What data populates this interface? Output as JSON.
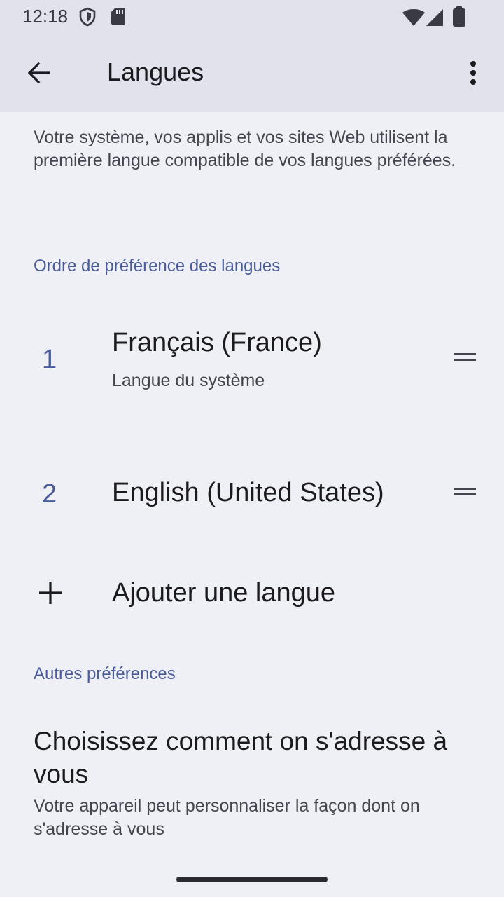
{
  "status_bar": {
    "time": "12:18",
    "icons": [
      "shield-icon",
      "sd-card-icon",
      "wifi-icon",
      "signal-icon",
      "battery-icon"
    ]
  },
  "app_bar": {
    "title": "Langues",
    "back_icon": "arrow-back-icon",
    "more_icon": "more-vert-icon"
  },
  "intro_text": "Votre système, vos applis et vos sites Web utilisent la première langue compatible de vos langues préférées.",
  "language_section": {
    "header": "Ordre de préférence des langues",
    "languages": [
      {
        "number": "1",
        "name": "Français (France)",
        "subtitle": "Langue du système"
      },
      {
        "number": "2",
        "name": "English (United States)",
        "subtitle": ""
      }
    ],
    "add_label": "Ajouter une langue"
  },
  "other_section": {
    "header": "Autres préférences",
    "title": "Choisissez comment on s'adresse à vous",
    "subtitle": "Votre appareil peut personnaliser la façon dont on s'adresse à vous"
  },
  "colors": {
    "background": "#efeff6",
    "app_bar": "#e2e2ec",
    "accent": "#4a5c9a"
  }
}
